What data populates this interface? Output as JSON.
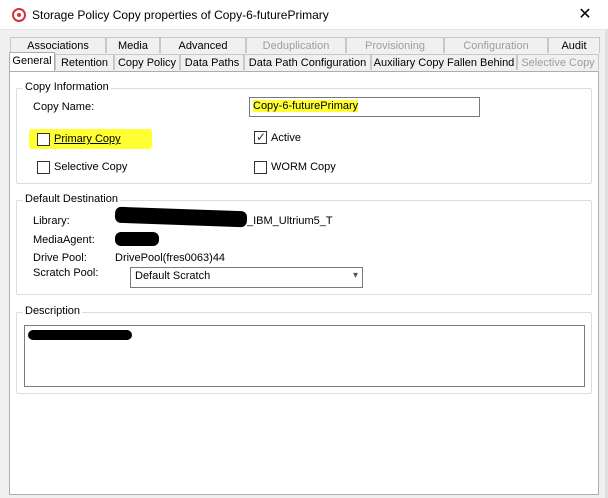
{
  "window": {
    "title": "Storage Policy Copy properties of Copy-6-futurePrimary",
    "close_glyph": "✕",
    "accent_color": "#d13438"
  },
  "tabs_row1": [
    {
      "label": "Associations",
      "enabled": true
    },
    {
      "label": "Media",
      "enabled": true
    },
    {
      "label": "Advanced",
      "enabled": true
    },
    {
      "label": "Deduplication",
      "enabled": false
    },
    {
      "label": "Provisioning",
      "enabled": false
    },
    {
      "label": "Configuration",
      "enabled": false
    },
    {
      "label": "Audit",
      "enabled": true
    }
  ],
  "tabs_row2": [
    {
      "label": "General",
      "enabled": true,
      "active": true
    },
    {
      "label": "Retention",
      "enabled": true
    },
    {
      "label": "Copy Policy",
      "enabled": true
    },
    {
      "label": "Data Paths",
      "enabled": true
    },
    {
      "label": "Data Path Configuration",
      "enabled": true
    },
    {
      "label": "Auxiliary Copy Fallen Behind",
      "enabled": true
    },
    {
      "label": "Selective Copy",
      "enabled": false
    }
  ],
  "copy_info": {
    "group_label": "Copy Information",
    "copy_name_label": "Copy Name:",
    "copy_name_value": "Copy-6-futurePrimary",
    "primary_copy": {
      "label": "Primary Copy",
      "checked": false
    },
    "active": {
      "label": "Active",
      "checked": true
    },
    "selective_copy": {
      "label": "Selective Copy",
      "checked": false
    },
    "worm_copy": {
      "label": "WORM Copy",
      "checked": false
    },
    "highlight_color": "#ffff32"
  },
  "default_destination": {
    "group_label": "Default Destination",
    "library_label": "Library:",
    "library_value": "_IBM_Ultrium5_T",
    "media_agent_label": "MediaAgent:",
    "drive_pool_label": "Drive Pool:",
    "drive_pool_value": "DrivePool(fres0063)44",
    "scratch_pool_label": "Scratch Pool:",
    "scratch_pool_value": "Default Scratch"
  },
  "description": {
    "group_label": "Description"
  }
}
